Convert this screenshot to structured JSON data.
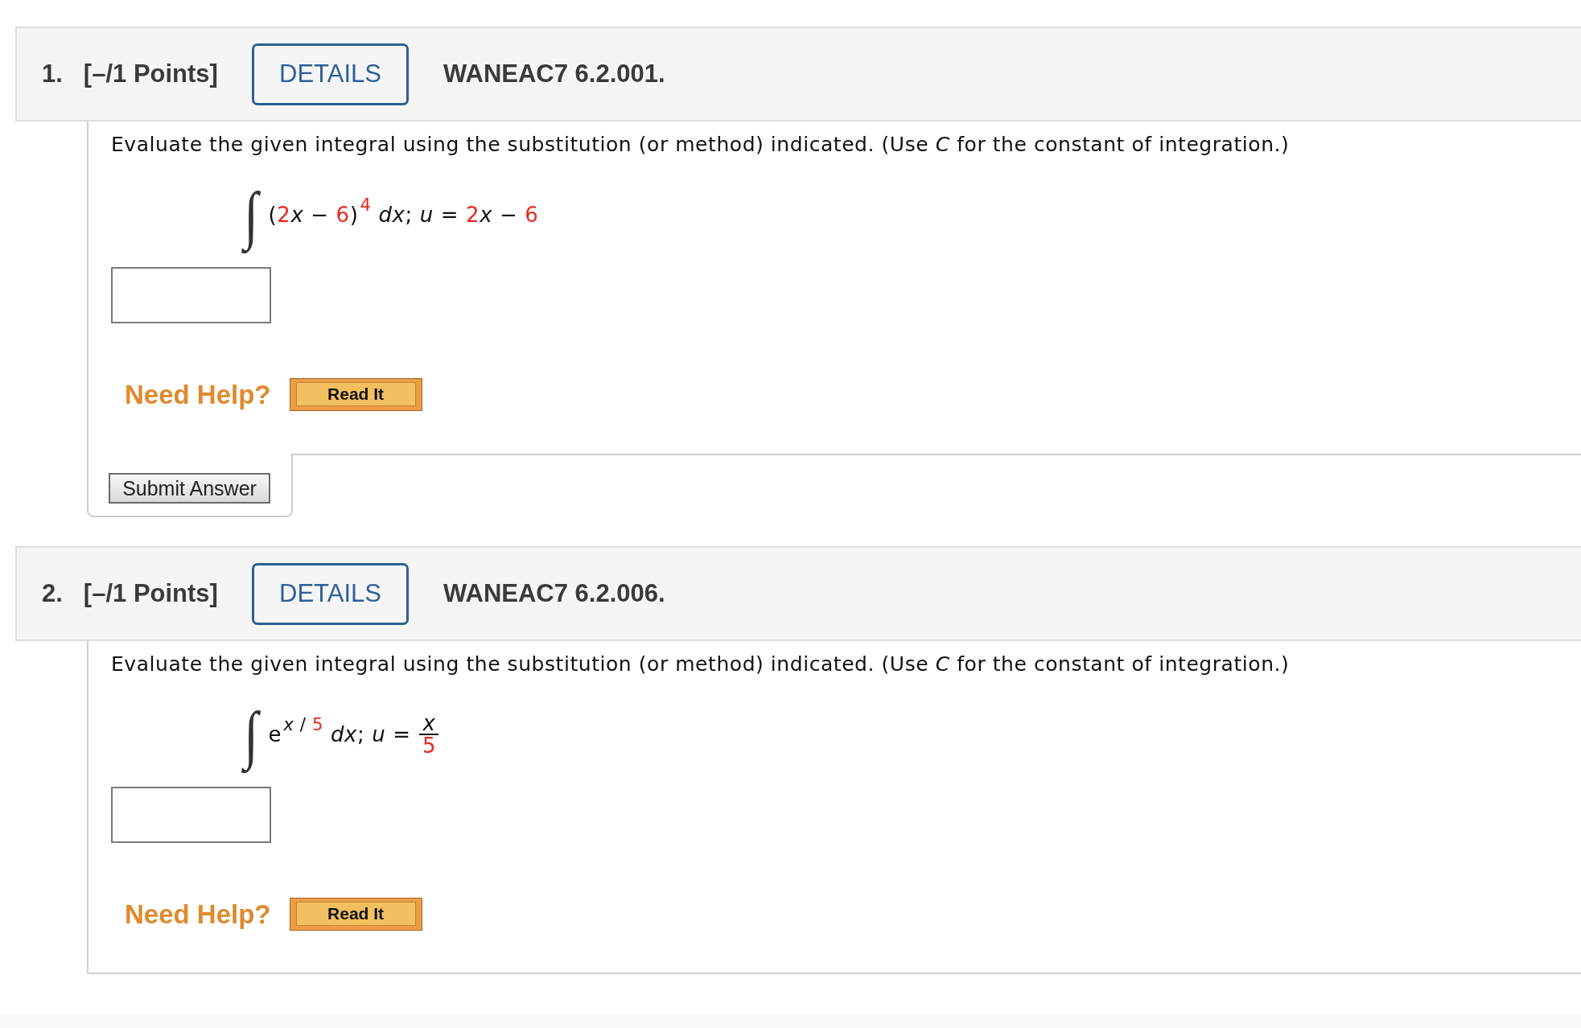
{
  "questions": [
    {
      "number": "1.",
      "points": "[–/1 Points]",
      "details_button": "DETAILS",
      "code": "WANEAC7 6.2.001.",
      "prompt": "Evaluate the given integral using the substitution (or method) indicated. (Use *C* for the constant of integration.)",
      "integral": {
        "sign": "∫",
        "terms": [
          {
            "kind": "symbol",
            "text": "("
          },
          {
            "kind": "number",
            "text": "2"
          },
          {
            "kind": "variable",
            "text": "x"
          },
          {
            "kind": "symbol",
            "text": " − "
          },
          {
            "kind": "number",
            "text": "6"
          },
          {
            "kind": "symbol",
            "text": ")"
          },
          {
            "kind": "power",
            "children": [
              {
                "kind": "number",
                "text": "4"
              }
            ]
          },
          {
            "kind": "variable",
            "text": " dx"
          },
          {
            "kind": "symbol",
            "text": "; "
          },
          {
            "kind": "variable",
            "text": "u"
          },
          {
            "kind": "symbol",
            "text": " = "
          },
          {
            "kind": "number",
            "text": "2"
          },
          {
            "kind": "variable",
            "text": "x"
          },
          {
            "kind": "symbol",
            "text": " − "
          },
          {
            "kind": "number",
            "text": "6"
          }
        ]
      },
      "answer": {
        "kind": "text_box"
      },
      "help": {
        "label": "Need Help?",
        "buttons": [
          "Read It"
        ]
      },
      "submit_button": "Submit Answer"
    },
    {
      "number": "2.",
      "points": "[–/1 Points]",
      "details_button": "DETAILS",
      "code": "WANEAC7 6.2.006.",
      "prompt": "Evaluate the given integral using the substitution (or method) indicated. (Use *C* for the constant of integration.)",
      "integral": {
        "sign": "∫",
        "terms": [
          {
            "kind": "symbol",
            "text": "e"
          },
          {
            "kind": "power",
            "children": [
              {
                "kind": "variable",
                "text": "x"
              },
              {
                "kind": "symbol",
                "text": " / "
              },
              {
                "kind": "number",
                "text": "5"
              }
            ]
          },
          {
            "kind": "variable",
            "text": " dx"
          },
          {
            "kind": "symbol",
            "text": "; "
          },
          {
            "kind": "variable",
            "text": "u"
          },
          {
            "kind": "symbol",
            "text": " = "
          },
          {
            "kind": "fraction",
            "numerator": [
              {
                "kind": "variable",
                "text": "x"
              }
            ],
            "denominator": [
              {
                "kind": "number",
                "text": "5"
              }
            ]
          }
        ]
      },
      "answer": {
        "kind": "text_box"
      },
      "help": {
        "label": "Need Help?",
        "buttons": [
          "Read It"
        ]
      }
    }
  ]
}
